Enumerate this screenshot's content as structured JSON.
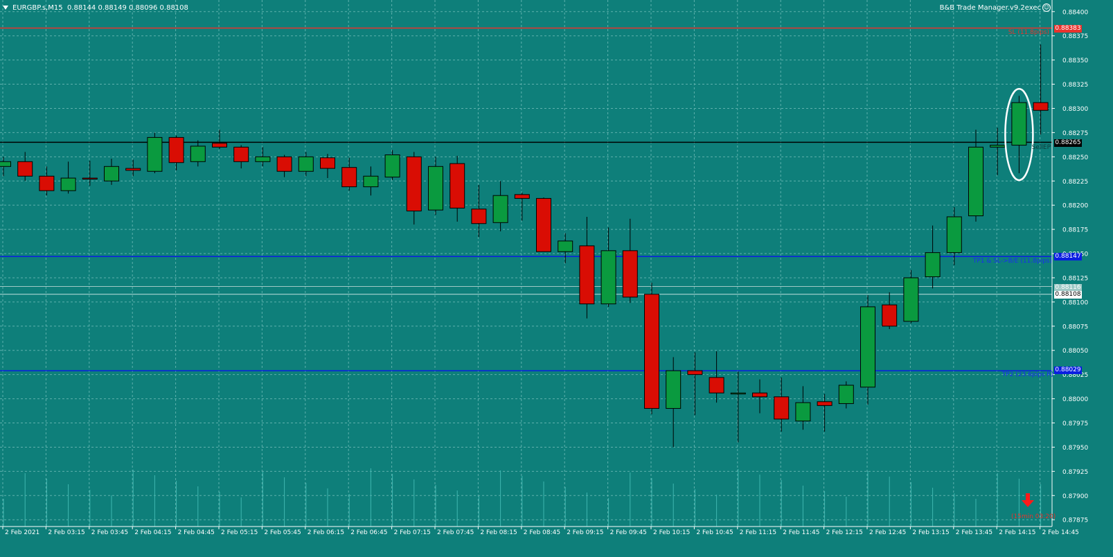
{
  "window": {
    "symbol_info": "EURGBP.s,M15  0.88144 0.88149 0.88096 0.88108",
    "expert_label": "B&B Trade Manager.v9.2exec"
  },
  "icons": {
    "menu": "triangle-down-icon",
    "expert": "smiley-icon",
    "signal": "sell-arrow-icon"
  },
  "colors": {
    "background": "#0e7f7a",
    "grid": "#5fb1ad",
    "bull": "#0a9a3f",
    "bear": "#d90d04",
    "sl_line": "#e8332d",
    "entry_line": "#000000",
    "tp_line": "#0a1ee0",
    "text": "#ffffff"
  },
  "lines": {
    "sl": {
      "price": 0.88383,
      "label": "SL (11.8pips)",
      "price_label": "0.88383"
    },
    "entry": {
      "price": 0.88265,
      "label": "SellEP",
      "price_label": "0.88265"
    },
    "tp1": {
      "price": 0.88147,
      "label": "TP1 & SL->B/E (11.8pips)",
      "price_label": "0.88147"
    },
    "tp2": {
      "price": 0.88029,
      "label": "TP2 (23.6pips R)",
      "price_label": "0.88029"
    },
    "bid": {
      "price": 0.88108,
      "price_label": "0.88108"
    },
    "ask": {
      "price": 0.88116,
      "price_label": "0.88116"
    }
  },
  "signal": {
    "label": "(15min 03:20)"
  },
  "chart_data": {
    "type": "candlestick",
    "symbol": "EURGBP.s",
    "timeframe": "M15",
    "ylim": [
      0.87868,
      0.88412
    ],
    "y_ticks": [
      "0.88400",
      "0.88375",
      "0.88350",
      "0.88325",
      "0.88300",
      "0.88275",
      "0.88250",
      "0.88225",
      "0.88200",
      "0.88175",
      "0.88150",
      "0.88125",
      "0.88100",
      "0.88075",
      "0.88050",
      "0.88025",
      "0.88000",
      "0.87975",
      "0.87950",
      "0.87925",
      "0.87900",
      "0.87875"
    ],
    "x_ticks": [
      "2 Feb 2021",
      "2 Feb 03:15",
      "2 Feb 03:45",
      "2 Feb 04:15",
      "2 Feb 04:45",
      "2 Feb 05:15",
      "2 Feb 05:45",
      "2 Feb 06:15",
      "2 Feb 06:45",
      "2 Feb 07:15",
      "2 Feb 07:45",
      "2 Feb 08:15",
      "2 Feb 08:45",
      "2 Feb 09:15",
      "2 Feb 09:45",
      "2 Feb 10:15",
      "2 Feb 10:45",
      "2 Feb 11:15",
      "2 Feb 11:45",
      "2 Feb 12:15",
      "2 Feb 12:45",
      "2 Feb 13:15",
      "2 Feb 13:45",
      "2 Feb 14:15",
      "2 Feb 14:45"
    ],
    "grid": true,
    "candles": [
      {
        "o": 0.8824,
        "h": 0.8825,
        "l": 0.8823,
        "c": 0.88245
      },
      {
        "o": 0.88245,
        "h": 0.88255,
        "l": 0.88225,
        "c": 0.8823
      },
      {
        "o": 0.8823,
        "h": 0.8824,
        "l": 0.8821,
        "c": 0.88215
      },
      {
        "o": 0.88215,
        "h": 0.88245,
        "l": 0.88212,
        "c": 0.88228
      },
      {
        "o": 0.88228,
        "h": 0.88246,
        "l": 0.8822,
        "c": 0.88227
      },
      {
        "o": 0.88225,
        "h": 0.88248,
        "l": 0.88221,
        "c": 0.8824
      },
      {
        "o": 0.88238,
        "h": 0.88247,
        "l": 0.8823,
        "c": 0.88236
      },
      {
        "o": 0.88235,
        "h": 0.88275,
        "l": 0.88233,
        "c": 0.8827
      },
      {
        "o": 0.8827,
        "h": 0.88272,
        "l": 0.88236,
        "c": 0.88244
      },
      {
        "o": 0.88245,
        "h": 0.88267,
        "l": 0.8824,
        "c": 0.88261
      },
      {
        "o": 0.88264,
        "h": 0.88278,
        "l": 0.88258,
        "c": 0.8826
      },
      {
        "o": 0.8826,
        "h": 0.88262,
        "l": 0.88238,
        "c": 0.88245
      },
      {
        "o": 0.88245,
        "h": 0.8826,
        "l": 0.8824,
        "c": 0.8825
      },
      {
        "o": 0.8825,
        "h": 0.88252,
        "l": 0.88229,
        "c": 0.88235
      },
      {
        "o": 0.88235,
        "h": 0.88255,
        "l": 0.8823,
        "c": 0.8825
      },
      {
        "o": 0.88249,
        "h": 0.88253,
        "l": 0.88228,
        "c": 0.88238
      },
      {
        "o": 0.88239,
        "h": 0.88249,
        "l": 0.88215,
        "c": 0.88219
      },
      {
        "o": 0.88219,
        "h": 0.8824,
        "l": 0.8821,
        "c": 0.8823
      },
      {
        "o": 0.88229,
        "h": 0.88257,
        "l": 0.88226,
        "c": 0.88252
      },
      {
        "o": 0.8825,
        "h": 0.88255,
        "l": 0.8818,
        "c": 0.88194
      },
      {
        "o": 0.88195,
        "h": 0.8825,
        "l": 0.8819,
        "c": 0.8824
      },
      {
        "o": 0.88243,
        "h": 0.88251,
        "l": 0.88183,
        "c": 0.88197
      },
      {
        "o": 0.88196,
        "h": 0.88221,
        "l": 0.88167,
        "c": 0.88181
      },
      {
        "o": 0.88182,
        "h": 0.88225,
        "l": 0.88173,
        "c": 0.8821
      },
      {
        "o": 0.88211,
        "h": 0.88213,
        "l": 0.88184,
        "c": 0.88207
      },
      {
        "o": 0.88207,
        "h": 0.88208,
        "l": 0.88165,
        "c": 0.88152
      },
      {
        "o": 0.88152,
        "h": 0.88171,
        "l": 0.8814,
        "c": 0.88163
      },
      {
        "o": 0.88158,
        "h": 0.88188,
        "l": 0.88083,
        "c": 0.88098
      },
      {
        "o": 0.88098,
        "h": 0.88177,
        "l": 0.88095,
        "c": 0.88153
      },
      {
        "o": 0.88153,
        "h": 0.88186,
        "l": 0.88099,
        "c": 0.88105
      },
      {
        "o": 0.88108,
        "h": 0.8812,
        "l": 0.87984,
        "c": 0.8799
      },
      {
        "o": 0.8799,
        "h": 0.88043,
        "l": 0.8795,
        "c": 0.88029
      },
      {
        "o": 0.88029,
        "h": 0.88048,
        "l": 0.87983,
        "c": 0.88025
      },
      {
        "o": 0.88022,
        "h": 0.88049,
        "l": 0.87996,
        "c": 0.88006
      },
      {
        "o": 0.88006,
        "h": 0.88028,
        "l": 0.87955,
        "c": 0.88006
      },
      {
        "o": 0.88006,
        "h": 0.8802,
        "l": 0.87985,
        "c": 0.88002
      },
      {
        "o": 0.88002,
        "h": 0.88022,
        "l": 0.87966,
        "c": 0.87979
      },
      {
        "o": 0.87977,
        "h": 0.88013,
        "l": 0.87968,
        "c": 0.87996
      },
      {
        "o": 0.87997,
        "h": 0.88005,
        "l": 0.87966,
        "c": 0.87993
      },
      {
        "o": 0.87995,
        "h": 0.88018,
        "l": 0.8799,
        "c": 0.88014
      },
      {
        "o": 0.88012,
        "h": 0.88107,
        "l": 0.87994,
        "c": 0.88095
      },
      {
        "o": 0.88097,
        "h": 0.8811,
        "l": 0.88072,
        "c": 0.88075
      },
      {
        "o": 0.8808,
        "h": 0.88133,
        "l": 0.88078,
        "c": 0.88125
      },
      {
        "o": 0.88126,
        "h": 0.88179,
        "l": 0.88114,
        "c": 0.88151
      },
      {
        "o": 0.88151,
        "h": 0.88198,
        "l": 0.88138,
        "c": 0.88188
      },
      {
        "o": 0.88189,
        "h": 0.88278,
        "l": 0.88183,
        "c": 0.8826
      },
      {
        "o": 0.8826,
        "h": 0.8828,
        "l": 0.88231,
        "c": 0.88262
      },
      {
        "o": 0.88262,
        "h": 0.88313,
        "l": 0.88233,
        "c": 0.88306
      },
      {
        "o": 0.88306,
        "h": 0.88366,
        "l": 0.88273,
        "c": 0.88298
      }
    ],
    "highlight_candle_index": 47
  }
}
